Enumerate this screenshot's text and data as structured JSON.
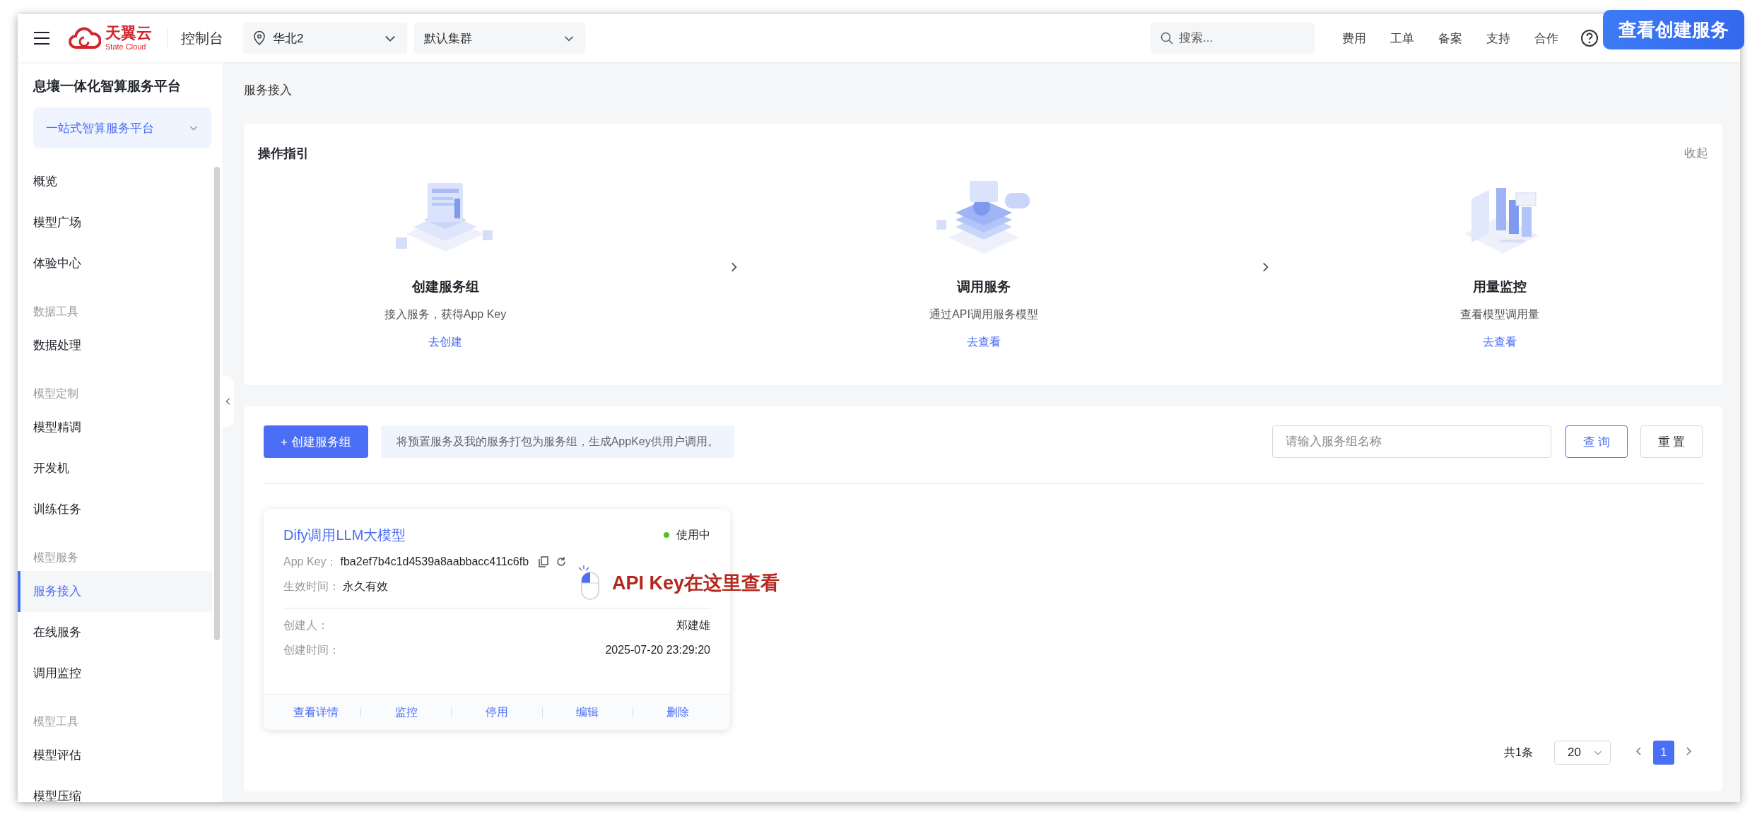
{
  "topbar": {
    "logo": {
      "name": "天翼云",
      "subtitle": "State Cloud"
    },
    "console": "控制台",
    "region": "华北2",
    "cluster": "默认集群",
    "search": {
      "placeholder": "搜索..."
    },
    "links": [
      "费用",
      "工单",
      "备案",
      "支持",
      "合作"
    ]
  },
  "overlay_badge": "查看创建服务",
  "sidebar": {
    "title": "息壤一体化智算服务平台",
    "platform": "一站式智算服务平台",
    "items": [
      {
        "kind": "item",
        "label": "概览",
        "selected": false
      },
      {
        "kind": "item",
        "label": "模型广场",
        "selected": false
      },
      {
        "kind": "item",
        "label": "体验中心",
        "selected": false
      },
      {
        "kind": "group",
        "label": "数据工具",
        "selected": false
      },
      {
        "kind": "item",
        "label": "数据处理",
        "selected": false
      },
      {
        "kind": "group",
        "label": "模型定制",
        "selected": false
      },
      {
        "kind": "item",
        "label": "模型精调",
        "selected": false
      },
      {
        "kind": "item",
        "label": "开发机",
        "selected": false
      },
      {
        "kind": "item",
        "label": "训练任务",
        "selected": false
      },
      {
        "kind": "group",
        "label": "模型服务",
        "selected": false
      },
      {
        "kind": "item",
        "label": "服务接入",
        "selected": true
      },
      {
        "kind": "item",
        "label": "在线服务",
        "selected": false
      },
      {
        "kind": "item",
        "label": "调用监控",
        "selected": false
      },
      {
        "kind": "group",
        "label": "模型工具",
        "selected": false
      },
      {
        "kind": "item",
        "label": "模型评估",
        "selected": false
      },
      {
        "kind": "item",
        "label": "模型压缩",
        "selected": false
      }
    ]
  },
  "breadcrumb": "服务接入",
  "guide": {
    "title": "操作指引",
    "collapse": "收起",
    "steps": [
      {
        "kind": "create",
        "title": "创建服务组",
        "description": "接入服务，获得App Key",
        "link": "去创建"
      },
      {
        "kind": "invoke",
        "title": "调用服务",
        "description": "通过API调用服务模型",
        "link": "去查看"
      },
      {
        "kind": "monitor",
        "title": "用量监控",
        "description": "查看模型调用量",
        "link": "去查看"
      }
    ]
  },
  "toolbar": {
    "create_button": "+ 创建服务组",
    "tip": "将预置服务及我的服务打包为服务组，生成AppKey供用户调用。",
    "search": {
      "placeholder": "请输入服务组名称"
    },
    "query_button": "查 询",
    "reset_button": "重 置"
  },
  "service_cards": [
    {
      "name": "Dify调用LLM大模型",
      "status": "使用中",
      "color": "#52c41a",
      "details": [
        {
          "label": "App Key：",
          "value": "fba2ef7b4c1d4539a8aabbacc411c6fb"
        },
        {
          "label": "生效时间：",
          "value": "永久有效"
        }
      ],
      "meta": [
        {
          "label": "创建人：",
          "value": "郑建雄"
        },
        {
          "label": "创建时间：",
          "value": "2025-07-20 23:29:20"
        }
      ],
      "actions": [
        "查看详情",
        "监控",
        "停用",
        "编辑",
        "删除"
      ]
    }
  ],
  "annotation": "API Key在这里查看",
  "pagination": {
    "total": "共1条",
    "page_size": "20",
    "pages": [
      {
        "label": "1",
        "selected": true
      }
    ]
  }
}
